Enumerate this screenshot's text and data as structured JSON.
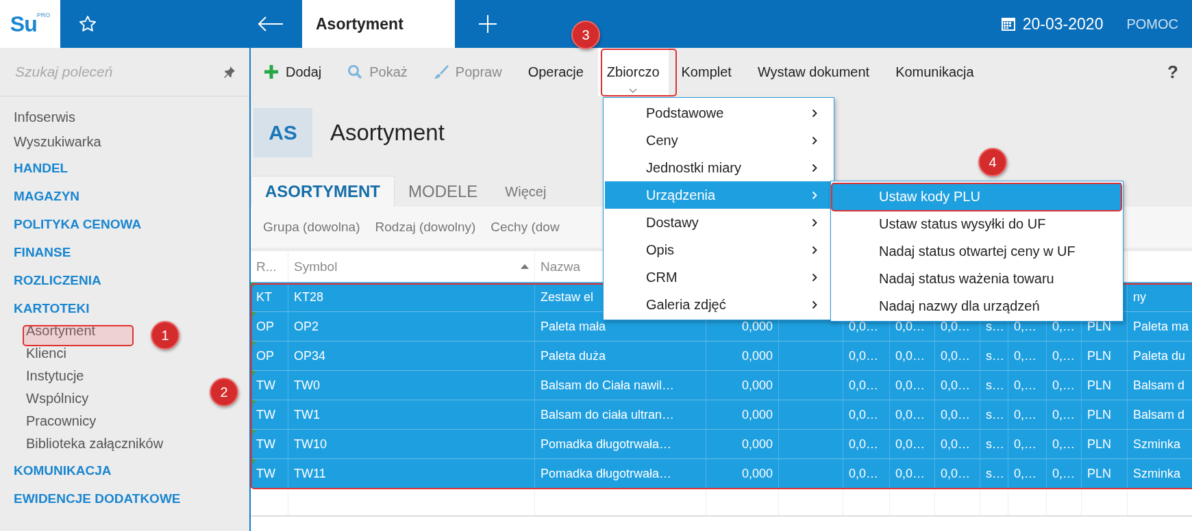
{
  "topbar": {
    "logo": {
      "text": "Su",
      "superscript": "PRO"
    },
    "tabs": [
      {
        "label": "Asortyment",
        "selected": true
      }
    ],
    "date": "20-03-2020",
    "help": "POMOC"
  },
  "sidebar": {
    "search": {
      "placeholder": "Szukaj poleceń"
    },
    "items": [
      {
        "kind": "link",
        "label": "Infoserwis"
      },
      {
        "kind": "link",
        "label": "Wyszukiwarka"
      },
      {
        "kind": "section",
        "label": "HANDEL"
      },
      {
        "kind": "section",
        "label": "MAGAZYN"
      },
      {
        "kind": "section",
        "label": "POLITYKA CENOWA"
      },
      {
        "kind": "section",
        "label": "FINANSE"
      },
      {
        "kind": "section",
        "label": "ROZLICZENIA"
      },
      {
        "kind": "section",
        "label": "KARTOTEKI",
        "children": [
          {
            "label": "Asortyment"
          },
          {
            "label": "Klienci"
          },
          {
            "label": "Instytucje"
          },
          {
            "label": "Wspólnicy"
          },
          {
            "label": "Pracownicy"
          },
          {
            "label": "Biblioteka załączników"
          }
        ]
      },
      {
        "kind": "section",
        "label": "KOMUNIKACJA"
      },
      {
        "kind": "section",
        "label": "EWIDENCJE DODATKOWE"
      }
    ]
  },
  "toolbar": {
    "items": [
      {
        "kind": "add",
        "label": "Dodaj",
        "disabled": false,
        "expanded": false
      },
      {
        "kind": "search",
        "label": "Pokaż",
        "disabled": true,
        "expanded": false
      },
      {
        "kind": "edit",
        "label": "Popraw",
        "disabled": true,
        "expanded": false
      },
      {
        "kind": "text",
        "label": "Operacje",
        "disabled": false,
        "expanded": false
      },
      {
        "kind": "text",
        "label": "Zbiorczo",
        "disabled": false,
        "expanded": true
      },
      {
        "kind": "text",
        "label": "Komplet",
        "disabled": false,
        "expanded": false
      },
      {
        "kind": "text",
        "label": "Wystaw dokument",
        "disabled": false,
        "expanded": false
      },
      {
        "kind": "text",
        "label": "Komunikacja",
        "disabled": false,
        "expanded": false
      }
    ],
    "help": "?"
  },
  "header": {
    "badge": "AS",
    "title": "Asortyment"
  },
  "tabs": [
    {
      "kind": "tab",
      "label": "ASORTYMENT",
      "selected": true
    },
    {
      "kind": "tab",
      "label": "MODELE",
      "selected": false
    },
    {
      "kind": "more",
      "label": "Więcej",
      "selected": false
    }
  ],
  "filters": [
    "Grupa (dowolna)",
    "Rodzaj (dowolny)",
    "Cechy (dow"
  ],
  "table": {
    "columns": [
      {
        "header": "R...",
        "sort_ascending": false
      },
      {
        "header": "Symbol",
        "sort_ascending": true
      },
      {
        "header": "Nazwa",
        "sort_ascending": false
      }
    ],
    "rows": [
      {
        "selected": true,
        "cells": [
          "KT",
          "KT28",
          "Zestaw el",
          null,
          null,
          null,
          null,
          null,
          null,
          null,
          null,
          null,
          "ny"
        ]
      },
      {
        "selected": true,
        "cells": [
          "OP",
          "OP2",
          "Paleta mała",
          "0,000",
          null,
          "0,0…",
          "0,0…",
          "0,0…",
          "s…",
          "0,…",
          "0,…",
          "PLN",
          "Paleta ma"
        ]
      },
      {
        "selected": true,
        "cells": [
          "OP",
          "OP34",
          "Paleta duża",
          "0,000",
          null,
          "0,0…",
          "0,0…",
          "0,0…",
          "s…",
          "0,…",
          "0,…",
          "PLN",
          "Paleta du"
        ]
      },
      {
        "selected": true,
        "cells": [
          "TW",
          "TW0",
          "Balsam do Ciała nawil…",
          "0,000",
          null,
          "0,0…",
          "0,0…",
          "0,0…",
          "s…",
          "0,…",
          "0,…",
          "PLN",
          "Balsam d"
        ]
      },
      {
        "selected": true,
        "cells": [
          "TW",
          "TW1",
          "Balsam do ciała ultran…",
          "0,000",
          null,
          "0,0…",
          "0,0…",
          "0,0…",
          "s…",
          "0,…",
          "0,…",
          "PLN",
          "Balsam d"
        ]
      },
      {
        "selected": true,
        "cells": [
          "TW",
          "TW10",
          "Pomadka długotrwała…",
          "0,000",
          null,
          "0,0…",
          "0,0…",
          "0,0…",
          "s…",
          "0,…",
          "0,…",
          "PLN",
          "Szminka"
        ]
      },
      {
        "selected": true,
        "cells": [
          "TW",
          "TW11",
          "Pomadka długotrwała…",
          "0,000",
          null,
          "0,0…",
          "0,0…",
          "0,0…",
          "s…",
          "0,…",
          "0,…",
          "PLN",
          "Szminka"
        ]
      }
    ]
  },
  "menu": {
    "items": [
      {
        "label": "Podstawowe",
        "selected": false
      },
      {
        "label": "Ceny",
        "selected": false
      },
      {
        "label": "Jednostki miary",
        "selected": false
      },
      {
        "label": "Urządzenia",
        "selected": true
      },
      {
        "label": "Dostawy",
        "selected": false
      },
      {
        "label": "Opis",
        "selected": false
      },
      {
        "label": "CRM",
        "selected": false
      },
      {
        "label": "Galeria zdjęć",
        "selected": false
      }
    ]
  },
  "submenu": {
    "items": [
      {
        "label": "Ustaw kody PLU",
        "selected": true
      },
      {
        "label": "Ustaw status wysyłki do UF",
        "selected": false
      },
      {
        "label": "Nadaj status otwartej ceny w UF",
        "selected": false
      },
      {
        "label": "Nadaj status ważenia towaru",
        "selected": false
      },
      {
        "label": "Nadaj nazwy dla urządzeń",
        "selected": false
      }
    ]
  },
  "annotations": [
    {
      "label": "1"
    },
    {
      "label": "2"
    },
    {
      "label": "3"
    },
    {
      "label": "4"
    }
  ]
}
